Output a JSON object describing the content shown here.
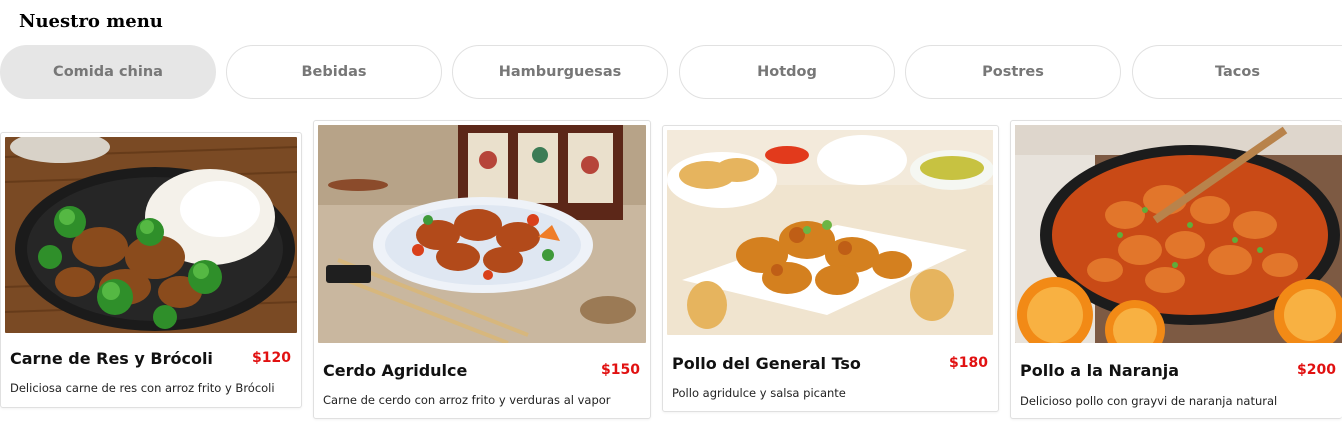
{
  "page": {
    "title": "Nuestro menu"
  },
  "tabs": [
    {
      "label": "Comida china",
      "active": true
    },
    {
      "label": "Bebidas",
      "active": false
    },
    {
      "label": "Hamburguesas",
      "active": false
    },
    {
      "label": "Hotdog",
      "active": false
    },
    {
      "label": "Postres",
      "active": false
    },
    {
      "label": "Tacos",
      "active": false
    }
  ],
  "products": [
    {
      "name": "Carne de Res y Brócoli",
      "price": "$120",
      "description": "Deliciosa carne de res con arroz frito y Brócoli"
    },
    {
      "name": "Cerdo Agridulce",
      "price": "$150",
      "description": "Carne de cerdo con arroz frito y verduras al vapor"
    },
    {
      "name": "Pollo del General Tso",
      "price": "$180",
      "description": "Pollo agridulce y salsa picante"
    },
    {
      "name": "Pollo a la Naranja",
      "price": "$200",
      "description": "Delicioso pollo con grayvi de naranja natural"
    }
  ],
  "colors": {
    "price": "#e11111",
    "tab_active_bg": "#e6e6e6",
    "tab_text": "#777777"
  }
}
